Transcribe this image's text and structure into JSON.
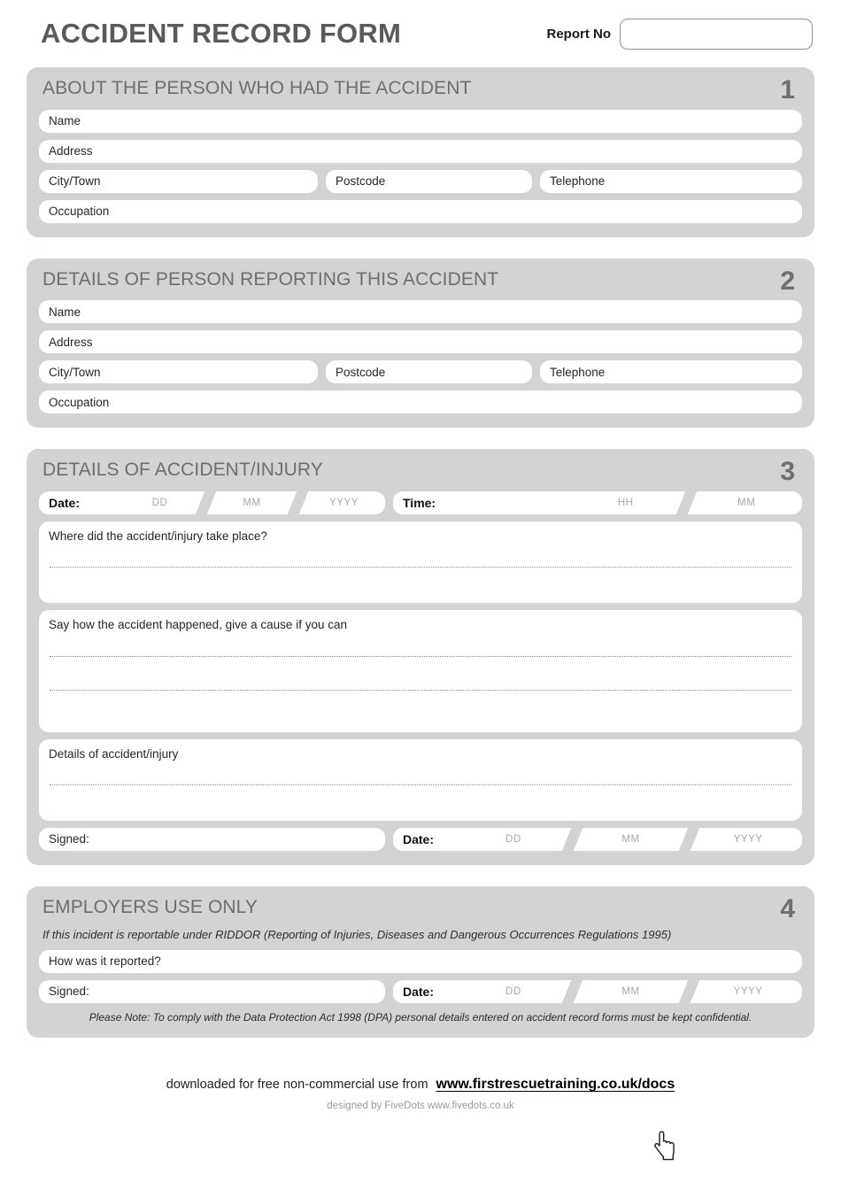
{
  "document": {
    "title": "ACCIDENT RECORD FORM",
    "report_no_label": "Report No",
    "report_no_value": ""
  },
  "sections": [
    {
      "number": "1",
      "title": "ABOUT THE PERSON WHO HAD THE ACCIDENT",
      "fields": {
        "name": "Name",
        "address": "Address",
        "city": "City/Town",
        "postcode": "Postcode",
        "telephone": "Telephone",
        "occupation": "Occupation"
      }
    },
    {
      "number": "2",
      "title": "DETAILS OF PERSON REPORTING THIS ACCIDENT",
      "fields": {
        "name": "Name",
        "address": "Address",
        "city": "City/Town",
        "postcode": "Postcode",
        "telephone": "Telephone",
        "occupation": "Occupation"
      }
    },
    {
      "number": "3",
      "title": "DETAILS OF ACCIDENT/INJURY",
      "date_label": "Date:",
      "date_dd": "DD",
      "date_mm": "MM",
      "date_yyyy": "YYYY",
      "time_label": "Time:",
      "time_hh": "HH",
      "time_mm": "MM",
      "where_label": "Where did the accident/injury take place?",
      "how_label": "Say how the accident happened, give a cause if you can",
      "details_label": "Details of accident/injury",
      "signed_label": "Signed:",
      "signed_date_label": "Date:",
      "signed_dd": "DD",
      "signed_mm": "MM",
      "signed_yyyy": "YYYY"
    },
    {
      "number": "4",
      "title": "EMPLOYERS USE ONLY",
      "subtitle": "If this incident is reportable under RIDDOR (Reporting of Injuries, Diseases and Dangerous Occurrences Regulations 1995)",
      "how_reported_label": "How was it reported?",
      "signed_label": "Signed:",
      "signed_date_label": "Date:",
      "signed_dd": "DD",
      "signed_mm": "MM",
      "signed_yyyy": "YYYY",
      "note": "Please Note: To comply with the Data Protection Act 1998 (DPA) personal details entered on accident record forms must be kept confidential."
    }
  ],
  "footer": {
    "downloaded_text": "downloaded for free non-commercial use from",
    "url": "www.firstrescuetraining.co.uk/docs",
    "designed_by": "designed by FiveDots www.fivedots.co.uk"
  },
  "colors": {
    "panel_background": "#d3d3d3",
    "field_background": "#ffffff",
    "heading_text": "#6e6e6e",
    "title_text": "#5a5a5a",
    "placeholder_text": "#a8a8a8",
    "page_background": "#ffffff"
  }
}
